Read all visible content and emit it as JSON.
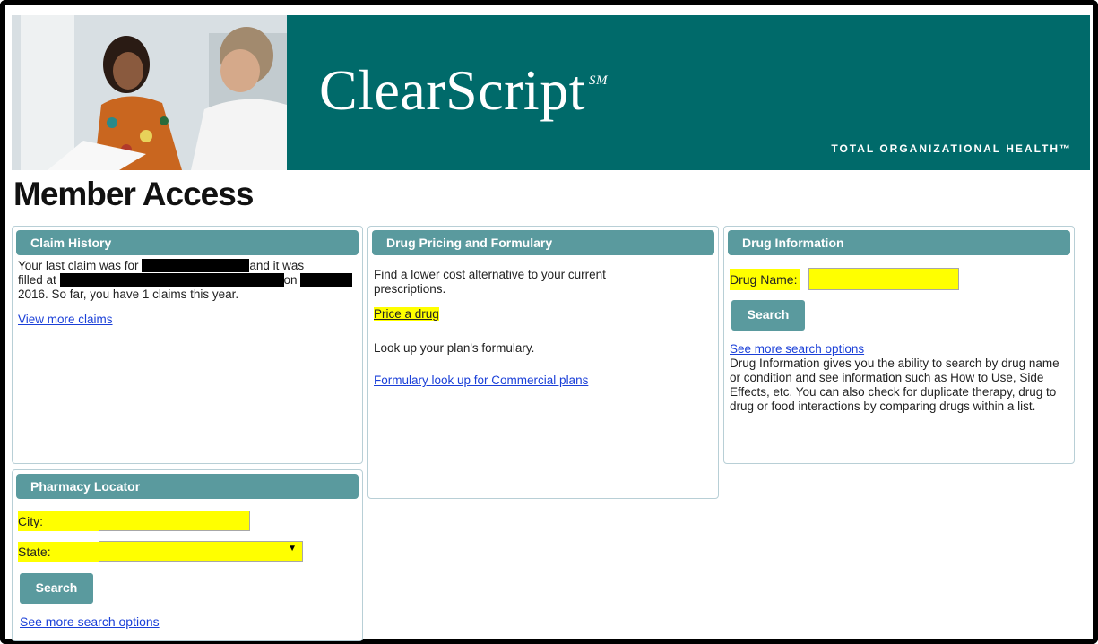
{
  "banner": {
    "brand_name": "ClearScript",
    "brand_mark": "SM",
    "tagline": "TOTAL ORGANIZATIONAL HEALTH™"
  },
  "page_title": "Member Access",
  "claim_history": {
    "heading": "Claim History",
    "text_1": "Your last claim was for",
    "text_2": "and it was",
    "text_3": "filled at",
    "text_4": "on",
    "text_5": "2016. So far, you have 1 claims this year.",
    "link": "View more claims"
  },
  "pharmacy_locator": {
    "heading": "Pharmacy Locator",
    "city_label": "City:",
    "city_value": "",
    "state_label": "State:",
    "state_value": "",
    "search_button": "Search",
    "more_link": "See more search options"
  },
  "drug_pricing": {
    "heading": "Drug Pricing and Formulary",
    "intro": "Find a lower cost alternative to your current prescriptions.",
    "price_link": "Price a drug",
    "formulary_text": "Look up your plan's formulary.",
    "formulary_link": "Formulary look up for Commercial plans"
  },
  "drug_information": {
    "heading": "Drug Information",
    "drug_name_label": "Drug Name:",
    "drug_name_value": "",
    "search_button": "Search",
    "more_link": "See more search options",
    "description": "Drug Information gives you the ability to search by drug name or condition and see information such as How to Use, Side Effects, etc. You can also check for duplicate therapy, drug to drug or food interactions by comparing drugs within a list."
  },
  "colors": {
    "banner_teal": "#006a6a",
    "panel_header": "#5a9a9e",
    "highlight": "#ffff00",
    "link_blue": "#1a3fd8"
  }
}
